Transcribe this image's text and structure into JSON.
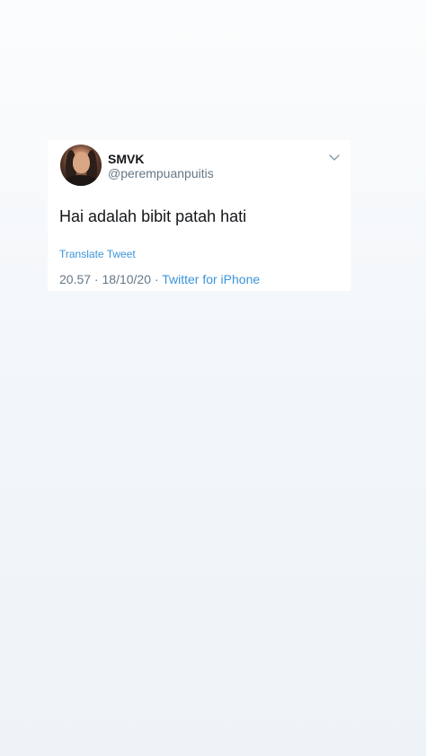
{
  "tweet": {
    "display_name": "SMVK",
    "handle": "@perempuanpuitis",
    "text": "Hai adalah bibit patah hati",
    "translate_label": "Translate Tweet",
    "time": "20.57",
    "separator_1": " · ",
    "date": "18/10/20",
    "separator_2": " · ",
    "source": "Twitter for iPhone",
    "menu_icon": "chevron-down-icon",
    "avatar_icon": "profile-photo"
  },
  "colors": {
    "text_primary": "#14171a",
    "text_secondary": "#657786",
    "link": "#3b94d9",
    "card_background": "#ffffff"
  }
}
